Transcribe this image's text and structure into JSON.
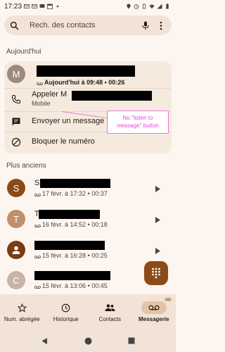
{
  "status_bar": {
    "time": "17:23"
  },
  "search": {
    "placeholder": "Rech. des contacts"
  },
  "sections": {
    "today": "Aujourd'hui",
    "older": "Plus anciens"
  },
  "expanded_call": {
    "avatar_letter": "M",
    "avatar_color": "#9a8a80",
    "meta": "Aujourd'hui à 09:48 • 00:26",
    "actions": {
      "call_label": "Appeler M",
      "call_sub": "Mobile",
      "message_label": "Envoyer un message",
      "block_label": "Bloquer le numéro"
    }
  },
  "annotation": {
    "line1": "No \"listen to",
    "line2": "message\" button"
  },
  "older_calls": [
    {
      "avatar_letter": "S",
      "avatar_color": "#8b4a16",
      "name": "S",
      "meta": "17 févr. à 17:32 • 00:37"
    },
    {
      "avatar_letter": "T",
      "avatar_color": "#c28f6b",
      "name": "T",
      "meta": "16 févr. à 14:52 • 00:18"
    },
    {
      "avatar_letter": "",
      "avatar_color": "#7a3c14",
      "name": "",
      "meta": "15 févr. à 16:28 • 00:25"
    },
    {
      "avatar_letter": "C",
      "avatar_color": "#c8b4a6",
      "name": "",
      "meta": "15 févr. à 13:06 • 00:45"
    }
  ],
  "bottom_nav": {
    "items": [
      {
        "label": "Num. abrégée",
        "icon": "star-icon"
      },
      {
        "label": "Historique",
        "icon": "clock-icon"
      },
      {
        "label": "Contacts",
        "icon": "people-icon"
      },
      {
        "label": "Messagerie",
        "icon": "voicemail-icon",
        "active": true
      }
    ]
  },
  "colors": {
    "accent": "#8b4a16",
    "background": "#fdf6f0",
    "card": "#f6eadf",
    "annotation": "#e046d4"
  }
}
